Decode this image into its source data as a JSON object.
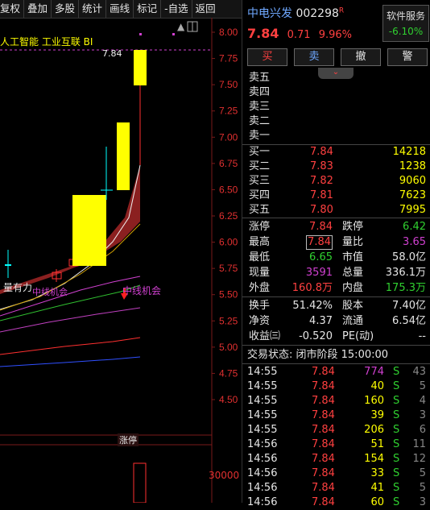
{
  "toolbar": {
    "items": [
      "复权",
      "叠加",
      "多股",
      "统计",
      "画线",
      "标记",
      "-自选",
      "返回"
    ]
  },
  "chart": {
    "concept_text": "人工智能  工业互联  BI",
    "price_axis": [
      "8.00",
      "7.75",
      "7.50",
      "7.25",
      "7.00",
      "6.75",
      "6.50",
      "6.25",
      "6.00",
      "5.75",
      "5.50",
      "5.25",
      "5.00",
      "4.75",
      "4.50"
    ],
    "high_callout": "7.84",
    "tag_left": "量有力",
    "tag_mid": "中线机会",
    "tag_right": "中线机会",
    "limit_tag": "涨停",
    "volume_axis": "30000",
    "colors": {
      "up": "#ffff00",
      "down": "#00ffff",
      "band": "#8b2020",
      "axis": "#e03030"
    }
  },
  "quote": {
    "name": "中电兴发",
    "code": "002298",
    "badge": "R",
    "price": "7.84",
    "change": "0.71",
    "change_pct": "9.96%",
    "service": {
      "label": "软件服务",
      "pct": "-6.10%"
    },
    "actions": [
      "买",
      "卖",
      "撤",
      "警"
    ],
    "sell_levels": [
      "卖五",
      "卖四",
      "卖三",
      "卖二",
      "卖一"
    ],
    "buy_levels": [
      {
        "label": "买一",
        "price": "7.84",
        "vol": "14218"
      },
      {
        "label": "买二",
        "price": "7.83",
        "vol": "1238"
      },
      {
        "label": "买三",
        "price": "7.82",
        "vol": "9060"
      },
      {
        "label": "买四",
        "price": "7.81",
        "vol": "7623"
      },
      {
        "label": "买五",
        "price": "7.80",
        "vol": "7995"
      }
    ],
    "stats1": [
      {
        "l1": "涨停",
        "v1": "7.84",
        "c1": "#ff4040",
        "l2": "跌停",
        "v2": "6.42",
        "c2": "#30d030"
      },
      {
        "l1": "最高",
        "v1": "7.84",
        "c1": "#ff4040",
        "l2": "量比",
        "v2": "3.65",
        "c2": "#d040d0"
      },
      {
        "l1": "最低",
        "v1": "6.65",
        "c1": "#30d030",
        "l2": "市值",
        "v2": "58.0亿",
        "c2": "#e6e6e6"
      },
      {
        "l1": "现量",
        "v1": "3591",
        "c1": "#d040d0",
        "l2": "总量",
        "v2": "336.1万",
        "c2": "#e6e6e6"
      },
      {
        "l1": "外盘",
        "v1": "160.8万",
        "c1": "#ff4040",
        "l2": "内盘",
        "v2": "175.3万",
        "c2": "#30d030"
      }
    ],
    "stats2": [
      {
        "l1": "换手",
        "v1": "51.42%",
        "l2": "股本",
        "v2": "7.40亿"
      },
      {
        "l1": "净资",
        "v1": "4.37",
        "l2": "流通",
        "v2": "6.54亿"
      },
      {
        "l1": "收益㈢",
        "v1": "-0.520",
        "l2": "PE(动)",
        "v2": "--"
      }
    ],
    "trade_status": "交易状态: 闭市阶段 15:00:00",
    "ticks": [
      {
        "time": "14:55",
        "price": "7.84",
        "vol": "774",
        "side": "S",
        "n": "43",
        "vc": "#d040d0"
      },
      {
        "time": "14:55",
        "price": "7.84",
        "vol": "40",
        "side": "S",
        "n": "5",
        "vc": "#ffff00"
      },
      {
        "time": "14:55",
        "price": "7.84",
        "vol": "160",
        "side": "S",
        "n": "4",
        "vc": "#ffff00"
      },
      {
        "time": "14:55",
        "price": "7.84",
        "vol": "39",
        "side": "S",
        "n": "3",
        "vc": "#ffff00"
      },
      {
        "time": "14:55",
        "price": "7.84",
        "vol": "206",
        "side": "S",
        "n": "6",
        "vc": "#ffff00"
      },
      {
        "time": "14:56",
        "price": "7.84",
        "vol": "51",
        "side": "S",
        "n": "11",
        "vc": "#ffff00"
      },
      {
        "time": "14:56",
        "price": "7.84",
        "vol": "154",
        "side": "S",
        "n": "12",
        "vc": "#ffff00"
      },
      {
        "time": "14:56",
        "price": "7.84",
        "vol": "33",
        "side": "S",
        "n": "5",
        "vc": "#ffff00"
      },
      {
        "time": "14:56",
        "price": "7.84",
        "vol": "41",
        "side": "S",
        "n": "5",
        "vc": "#ffff00"
      },
      {
        "time": "14:56",
        "price": "7.84",
        "vol": "60",
        "side": "S",
        "n": "3",
        "vc": "#ffff00"
      }
    ]
  }
}
